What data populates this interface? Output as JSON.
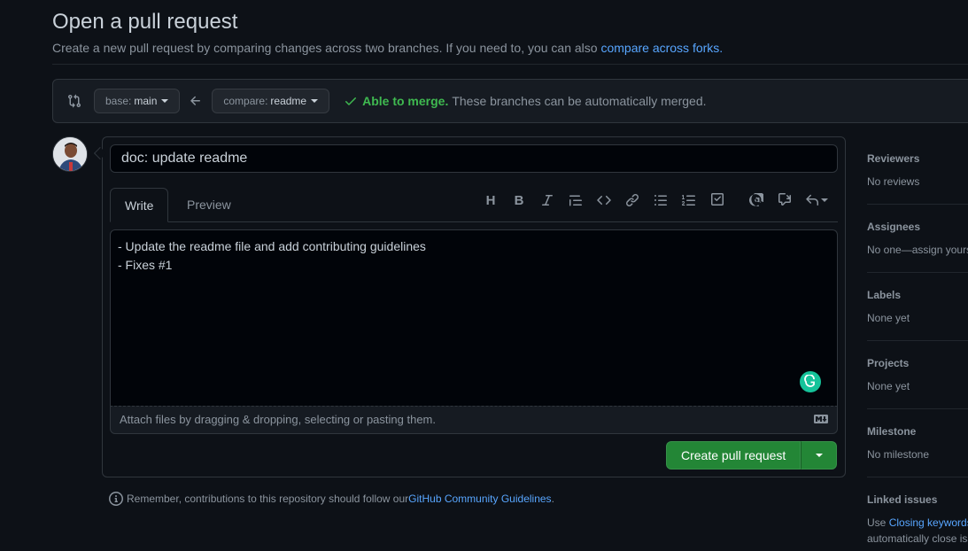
{
  "header": {
    "title": "Open a pull request",
    "subtitle": "Create a new pull request by comparing changes across two branches. If you need to, you can also ",
    "subtitle_link": "compare across forks."
  },
  "compare": {
    "base_prefix": "base:",
    "base_branch": "main",
    "compare_prefix": "compare:",
    "compare_branch": "readme",
    "merge_status": "Able to merge.",
    "merge_detail": "These branches can be automatically merged."
  },
  "form": {
    "title_value": "doc: update readme",
    "tabs": [
      {
        "label": "Write"
      },
      {
        "label": "Preview"
      }
    ],
    "body_lines": [
      "- Update the readme file and add contributing guidelines",
      "- Fixes #1"
    ],
    "attach_hint": "Attach files by dragging & dropping, selecting or pasting them.",
    "submit_label": "Create pull request",
    "toolbar_icons": [
      "heading-icon",
      "bold-icon",
      "italic-icon",
      "quote-icon",
      "code-icon",
      "link-icon",
      "bulleted-list-icon",
      "numbered-list-icon",
      "task-list-icon",
      "mention-icon",
      "cross-reference-icon",
      "saved-replies-icon"
    ]
  },
  "note": {
    "text": "Remember, contributions to this repository should follow our ",
    "link": "GitHub Community Guidelines",
    "suffix": "."
  },
  "sidebar": {
    "reviewers": {
      "label": "Reviewers",
      "value": "No reviews"
    },
    "assignees": {
      "label": "Assignees",
      "value": "No one—assign yours"
    },
    "labels": {
      "label": "Labels",
      "value": "None yet"
    },
    "projects": {
      "label": "Projects",
      "value": "None yet"
    },
    "milestone": {
      "label": "Milestone",
      "value": "No milestone"
    },
    "linked": {
      "label": "Linked issues",
      "prefix": "Use ",
      "link": "Closing keywords",
      "line2": "automatically close iss"
    }
  },
  "colors": {
    "accent": "#58a6ff",
    "success": "#3fb950",
    "button": "#238636",
    "background": "#0d1117"
  }
}
